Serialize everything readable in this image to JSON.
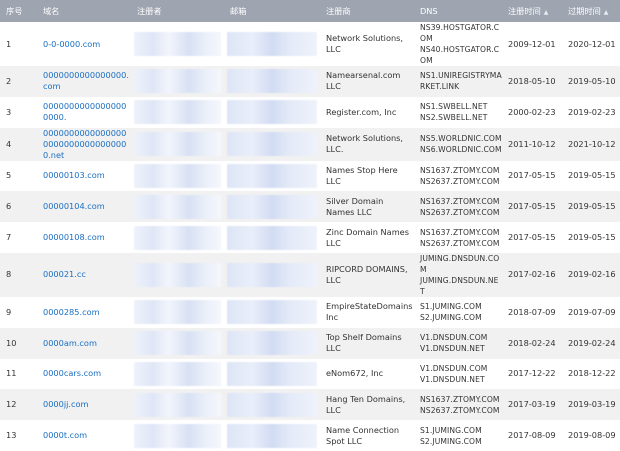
{
  "headers": {
    "index": "序号",
    "domain": "域名",
    "registrant": "注册者",
    "email": "邮箱",
    "registrar": "注册商",
    "dns": "DNS",
    "reg_date": "注册时间",
    "exp_date": "过期时间"
  },
  "rows": [
    {
      "index": "1",
      "domain": "0-0-0000.com",
      "registrar": "Network Solutions, LLC",
      "dns": [
        "NS39.HOSTGATOR.COM",
        "NS40.HOSTGATOR.COM"
      ],
      "reg_date": "2009-12-01",
      "exp_date": "2020-12-01"
    },
    {
      "index": "2",
      "domain": "0000000000000000.com",
      "registrar": "Namearsenal.com LLC",
      "dns": [
        "NS1.UNIREGISTRYMARKET.LINK",
        ""
      ],
      "reg_date": "2018-05-10",
      "exp_date": "2019-05-10"
    },
    {
      "index": "3",
      "domain": "00000000000000000000.",
      "registrar": "Register.com, Inc",
      "dns": [
        "NS1.SWBELL.NET",
        "NS2.SWBELL.NET"
      ],
      "reg_date": "2000-02-23",
      "exp_date": "2019-02-23"
    },
    {
      "index": "4",
      "domain": "000000000000000000000000000000000.net",
      "registrar": "Network Solutions, LLC.",
      "dns": [
        "NS5.WORLDNIC.COM",
        "NS6.WORLDNIC.COM"
      ],
      "reg_date": "2011-10-12",
      "exp_date": "2021-10-12"
    },
    {
      "index": "5",
      "domain": "00000103.com",
      "registrar": "Names Stop Here LLC",
      "dns": [
        "NS1637.ZTOMY.COM",
        "NS2637.ZTOMY.COM"
      ],
      "reg_date": "2017-05-15",
      "exp_date": "2019-05-15"
    },
    {
      "index": "6",
      "domain": "00000104.com",
      "registrar": "Silver Domain Names LLC",
      "dns": [
        "NS1637.ZTOMY.COM",
        "NS2637.ZTOMY.COM"
      ],
      "reg_date": "2017-05-15",
      "exp_date": "2019-05-15"
    },
    {
      "index": "7",
      "domain": "00000108.com",
      "registrar": "Zinc Domain Names LLC",
      "dns": [
        "NS1637.ZTOMY.COM",
        "NS2637.ZTOMY.COM"
      ],
      "reg_date": "2017-05-15",
      "exp_date": "2019-05-15"
    },
    {
      "index": "8",
      "domain": "000021.cc",
      "registrar": "RIPCORD DOMAINS, LLC",
      "dns": [
        "JUMING.DNSDUN.COM",
        "JUMING.DNSDUN.NET"
      ],
      "reg_date": "2017-02-16",
      "exp_date": "2019-02-16"
    },
    {
      "index": "9",
      "domain": "0000285.com",
      "registrar": "EmpireStateDomains Inc",
      "dns": [
        "S1.JUMING.COM",
        "S2.JUMING.COM"
      ],
      "reg_date": "2018-07-09",
      "exp_date": "2019-07-09"
    },
    {
      "index": "10",
      "domain": "0000am.com",
      "registrar": "Top Shelf Domains LLC",
      "dns": [
        "V1.DNSDUN.COM",
        "V1.DNSDUN.NET"
      ],
      "reg_date": "2018-02-24",
      "exp_date": "2019-02-24"
    },
    {
      "index": "11",
      "domain": "0000cars.com",
      "registrar": "eNom672, Inc",
      "dns": [
        "V1.DNSDUN.COM",
        "V1.DNSDUN.NET"
      ],
      "reg_date": "2017-12-22",
      "exp_date": "2018-12-22"
    },
    {
      "index": "12",
      "domain": "0000jj.com",
      "registrar": "Hang Ten Domains, LLC",
      "dns": [
        "NS1637.ZTOMY.COM",
        "NS2637.ZTOMY.COM"
      ],
      "reg_date": "2017-03-19",
      "exp_date": "2019-03-19"
    },
    {
      "index": "13",
      "domain": "0000t.com",
      "registrar": "Name Connection Spot LLC",
      "dns": [
        "S1.JUMING.COM",
        "S2.JUMING.COM"
      ],
      "reg_date": "2017-08-09",
      "exp_date": "2019-08-09"
    }
  ]
}
